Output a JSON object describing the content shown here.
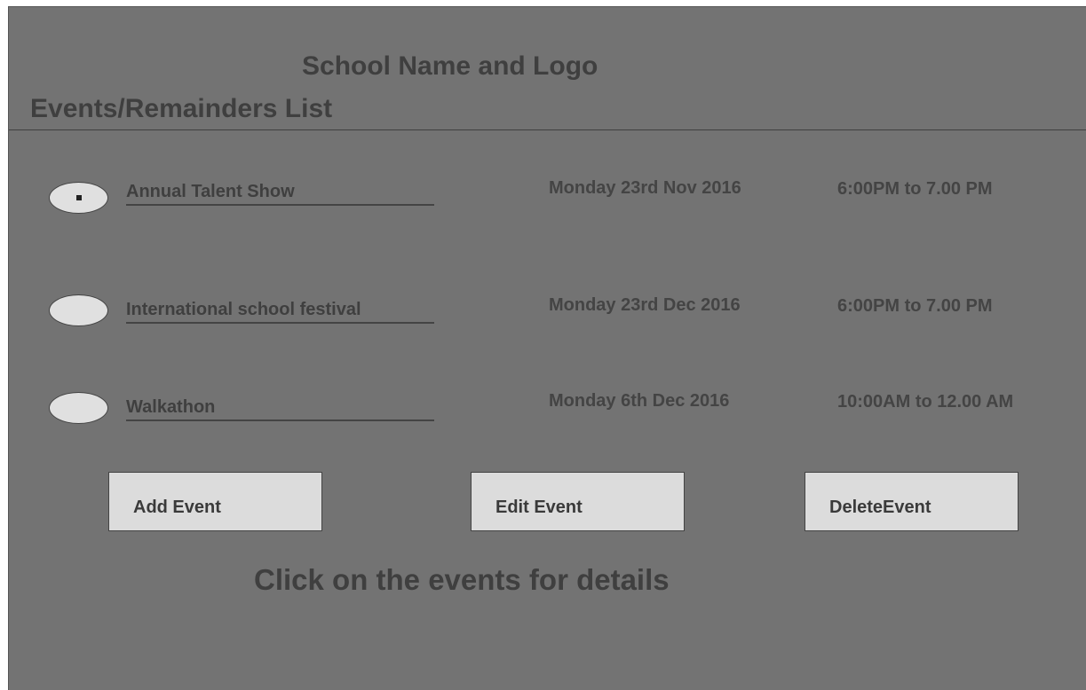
{
  "header": {
    "school_title": "School Name and Logo",
    "list_title": "Events/Remainders List"
  },
  "events": [
    {
      "name": "Annual Talent Show",
      "date": "Monday 23rd Nov 2016",
      "time": "6:00PM to 7.00 PM",
      "selected": true
    },
    {
      "name": "International school festival",
      "date": "Monday 23rd Dec 2016",
      "time": "6:00PM to 7.00 PM",
      "selected": false
    },
    {
      "name": "Walkathon",
      "date": "Monday 6th Dec 2016",
      "time": "10:00AM to 12.00 AM",
      "selected": false
    }
  ],
  "actions": {
    "add_label": "Add Event",
    "edit_label": "Edit Event",
    "delete_label": "DeleteEvent"
  },
  "footer": {
    "hint": "Click on the events for details"
  },
  "colors": {
    "background": "#737373",
    "text": "#3f3f3f",
    "button_fill": "#dcdcdc",
    "radio_fill": "#e0e0e0"
  }
}
